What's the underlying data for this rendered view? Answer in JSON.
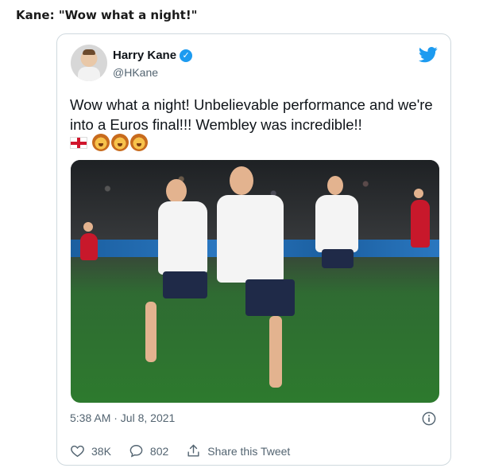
{
  "headline": "Kane: \"Wow what a night!\"",
  "tweet": {
    "author_name": "Harry Kane",
    "handle": "@HKane",
    "text": "Wow what a night! Unbelievable performance and we're into a Euros final!!! Wembley was incredible!!",
    "emojis": [
      "england-flag",
      "lion-face",
      "lion-face",
      "lion-face"
    ],
    "timestamp": "5:38 AM · Jul 8, 2021"
  },
  "actions": {
    "likes": "38K",
    "replies": "802",
    "share_label": "Share this Tweet"
  },
  "colors": {
    "twitter_blue": "#1d9bf0",
    "muted_text": "#536471",
    "border": "#cfd9de"
  }
}
